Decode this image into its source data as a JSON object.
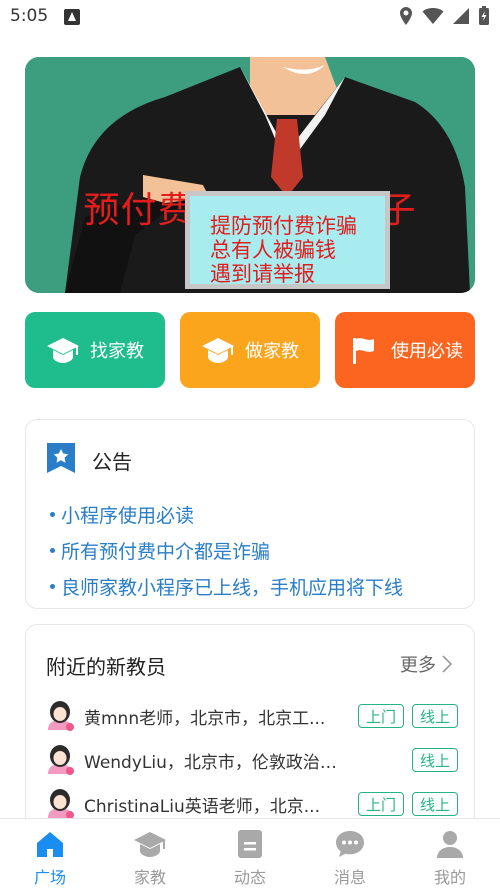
{
  "status_bar": {
    "time": "5:05"
  },
  "banner": {
    "headline": "预付费中介都是骗子",
    "board_lines": [
      "提防预付费诈骗",
      "总有人被骗钱",
      "遇到请举报"
    ]
  },
  "actions": [
    {
      "label": "找家教",
      "icon": "graduation-cap-icon",
      "color": "#1fbc8e"
    },
    {
      "label": "做家教",
      "icon": "graduation-cap-icon",
      "color": "#fba51d"
    },
    {
      "label": "使用必读",
      "icon": "flag-icon",
      "color": "#fb6520"
    }
  ],
  "notice": {
    "title": "公告",
    "items": [
      "小程序使用必读",
      "所有预付费中介都是诈骗",
      "良师家教小程序已上线，手机应用将下线"
    ]
  },
  "nearby": {
    "title": "附近的新教员",
    "more_label": "更多",
    "teachers": [
      {
        "name": "黄mnn老师，北京市，北京工...",
        "tags": [
          "上门",
          "线上"
        ]
      },
      {
        "name": "WendyLiu，北京市，伦敦政治经济...",
        "tags": [
          "线上"
        ]
      },
      {
        "name": "ChristinaLiu英语老师，北京...",
        "tags": [
          "上门",
          "线上"
        ]
      }
    ]
  },
  "tabbar": {
    "active": "广场",
    "tabs": [
      {
        "label": "广场",
        "icon": "home-icon"
      },
      {
        "label": "家教",
        "icon": "graduation-cap-icon"
      },
      {
        "label": "动态",
        "icon": "document-icon"
      },
      {
        "label": "消息",
        "icon": "chat-bubble-icon"
      },
      {
        "label": "我的",
        "icon": "user-icon"
      }
    ]
  },
  "colors": {
    "accent": "#1a8ef0",
    "tag_green": "#26b484",
    "notice_blue": "#2a7ec8"
  }
}
